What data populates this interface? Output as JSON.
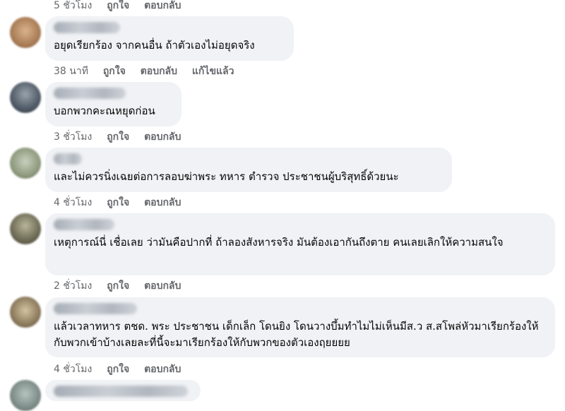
{
  "comments": [
    {
      "text": "",
      "time": "5 ชั่วโมง",
      "like": "ถูกใจ",
      "reply": "ตอบกลับ",
      "edited": "",
      "avatar_color": "#a97d56"
    },
    {
      "text": "อยุดเรียกร้อง จากคนอื่น ถ้าตัวเองไม่อยุดจริง",
      "time": "38 นาที",
      "like": "ถูกใจ",
      "reply": "ตอบกลับ",
      "edited": "แก้ไขแล้ว",
      "avatar_color": "#b5886a"
    },
    {
      "text": "บอกพวกคะณหยุดก่อน",
      "time": "3 ชั่วโมง",
      "like": "ถูกใจ",
      "reply": "ตอบกลับ",
      "edited": "",
      "avatar_color": "#5a6470"
    },
    {
      "text": "และไม่ควรนิ่งเฉยต่อการลอบฆ่าพระ ทหาร ตำรวจ ประชาชนผู้บริสุทธิ์ด้วยนะ",
      "time": "4 ชั่วโมง",
      "like": "ถูกใจ",
      "reply": "ตอบกลับ",
      "edited": "",
      "avatar_color": "#8f9a7e"
    },
    {
      "text": "เหตุการณ์นี่ เชื่อเลย ว่ามันคือปากที่ ถ้าลองสังหารจริง มันต้องเอากันถึงตาย คนเลยเลิกให้ความสนใจ",
      "time": "2 ชั่วโมง",
      "like": "ถูกใจ",
      "reply": "ตอบกลับ",
      "edited": "",
      "avatar_color": "#6d6a55"
    },
    {
      "text": "แล้วเวลาทหาร ตชด. พระ ประชาชน เด็กเล็ก โดนยิง โดนวางบึ้มทำไมไม่เห็นมีส.ว ส.สโพล่หัวมาเรียกร้องให้กับพวกเข้าบ้างเลยละที่นี้จะมาเรียกร้องให้กับพวกของตัวเองฤยยยย",
      "time": "4 ชั่วโมง",
      "like": "ถูกใจ",
      "reply": "ตอบกลับ",
      "edited": "",
      "avatar_color": "#8c7a5c"
    }
  ]
}
